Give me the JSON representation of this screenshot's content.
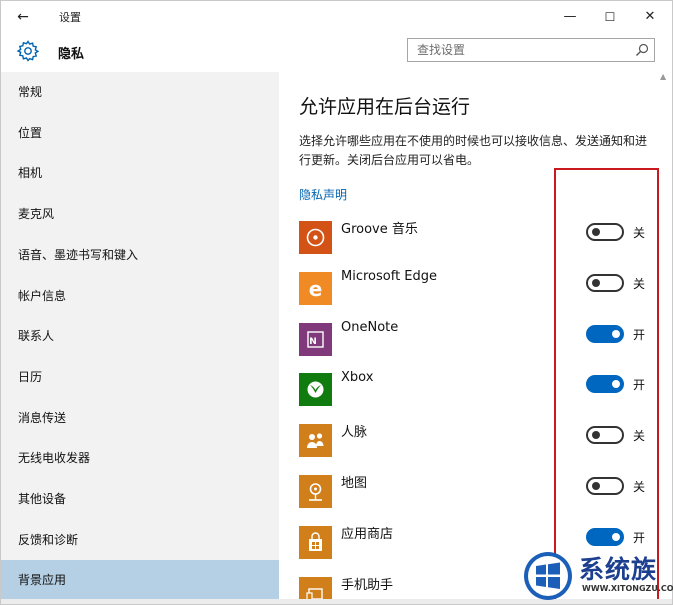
{
  "window": {
    "title": "设置"
  },
  "header": {
    "section_title": "隐私",
    "search_placeholder": "查找设置"
  },
  "controls": {
    "back": "←",
    "minimize": "—",
    "maximize": "☐",
    "close": "✕"
  },
  "sidebar": {
    "items": [
      {
        "label": "常规"
      },
      {
        "label": "位置"
      },
      {
        "label": "相机"
      },
      {
        "label": "麦克风"
      },
      {
        "label": "语音、墨迹书写和键入"
      },
      {
        "label": "帐户信息"
      },
      {
        "label": "联系人"
      },
      {
        "label": "日历"
      },
      {
        "label": "消息传送"
      },
      {
        "label": "无线电收发器"
      },
      {
        "label": "其他设备"
      },
      {
        "label": "反馈和诊断"
      },
      {
        "label": "背景应用",
        "active": true
      }
    ]
  },
  "content": {
    "heading": "允许应用在后台运行",
    "description": "选择允许哪些应用在不使用的时候也可以接收信息、发送通知和进行更新。关闭后台应用可以省电。",
    "privacy_link": "隐私声明",
    "apps": [
      {
        "name": "Groove 音乐",
        "icon": "groove-music-icon",
        "state": "关",
        "on": false,
        "color": "#d35215"
      },
      {
        "name": "Microsoft Edge",
        "icon": "edge-icon",
        "state": "关",
        "on": false,
        "color": "#f08a24"
      },
      {
        "name": "OneNote",
        "icon": "onenote-icon",
        "state": "开",
        "on": true,
        "color": "#80397b"
      },
      {
        "name": "Xbox",
        "icon": "xbox-icon",
        "state": "开",
        "on": true,
        "color": "#107c10"
      },
      {
        "name": "人脉",
        "icon": "people-icon",
        "state": "关",
        "on": false,
        "color": "#d07f1a"
      },
      {
        "name": "地图",
        "icon": "maps-icon",
        "state": "关",
        "on": false,
        "color": "#d07f1a"
      },
      {
        "name": "应用商店",
        "icon": "store-icon",
        "state": "开",
        "on": true,
        "color": "#d07f1a"
      },
      {
        "name": "手机助手",
        "icon": "phone-companion-icon",
        "state": "",
        "on": false,
        "color": "#d07f1a"
      }
    ]
  },
  "watermark": {
    "text": "系统族",
    "url": "WWW.XITONGZU.COM"
  },
  "colors": {
    "accent": "#0067c0",
    "active_nav": "#b5cfe4",
    "highlight": "#c8191f"
  }
}
